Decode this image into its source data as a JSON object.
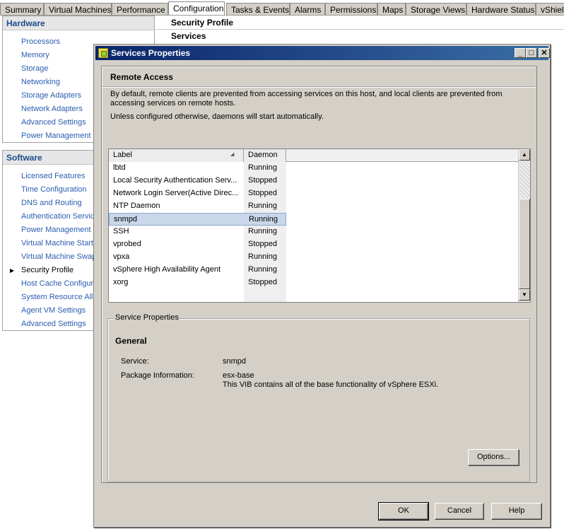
{
  "tabs": [
    "Summary",
    "Virtual Machines",
    "Performance",
    "Configuration",
    "Tasks & Events",
    "Alarms",
    "Permissions",
    "Maps",
    "Storage Views",
    "Hardware Status",
    "vShield"
  ],
  "active_tab": "Configuration",
  "left_nav": {
    "hardware": {
      "title": "Hardware",
      "items": [
        "Processors",
        "Memory",
        "Storage",
        "Networking",
        "Storage Adapters",
        "Network Adapters",
        "Advanced Settings",
        "Power Management"
      ]
    },
    "software": {
      "title": "Software",
      "items": [
        "Licensed Features",
        "Time Configuration",
        "DNS and Routing",
        "Authentication Servic",
        "Power Management",
        "Virtual Machine Startu",
        "Virtual Machine Swapf",
        "Security Profile",
        "Host Cache Configura",
        "System Resource Allo",
        "Agent VM Settings",
        "Advanced Settings"
      ],
      "current": "Security Profile"
    }
  },
  "content": {
    "section_title": "Security Profile",
    "services_title": "Services"
  },
  "dialog": {
    "title": "Services Properties",
    "remote_access_title": "Remote Access",
    "description_1": "By default, remote clients are prevented from accessing services on this host, and local clients are prevented from accessing services on remote hosts.",
    "description_2": "Unless configured otherwise, daemons will start automatically.",
    "columns": [
      "Label",
      "Daemon"
    ],
    "rows": [
      {
        "label": "lbtd",
        "daemon": "Running"
      },
      {
        "label": "Local Security Authentication Serv...",
        "daemon": "Stopped"
      },
      {
        "label": "Network Login Server(Active Direc...",
        "daemon": "Stopped"
      },
      {
        "label": "NTP Daemon",
        "daemon": "Running"
      },
      {
        "label": "snmpd",
        "daemon": "Running"
      },
      {
        "label": "SSH",
        "daemon": "Running"
      },
      {
        "label": "vprobed",
        "daemon": "Stopped"
      },
      {
        "label": "vpxa",
        "daemon": "Running"
      },
      {
        "label": "vSphere High Availability Agent",
        "daemon": "Running"
      },
      {
        "label": "xorg",
        "daemon": "Stopped"
      }
    ],
    "selected_row": "snmpd",
    "service_properties": {
      "group_title": "Service Properties",
      "general_title": "General",
      "service_label": "Service:",
      "service_value": "snmpd",
      "package_label": "Package Information:",
      "package_name": "esx-base",
      "package_desc": "This VIB contains all of the base functionality of vSphere ESXi."
    },
    "options_button": "Options...",
    "ok_button": "OK",
    "cancel_button": "Cancel",
    "help_button": "Help"
  }
}
